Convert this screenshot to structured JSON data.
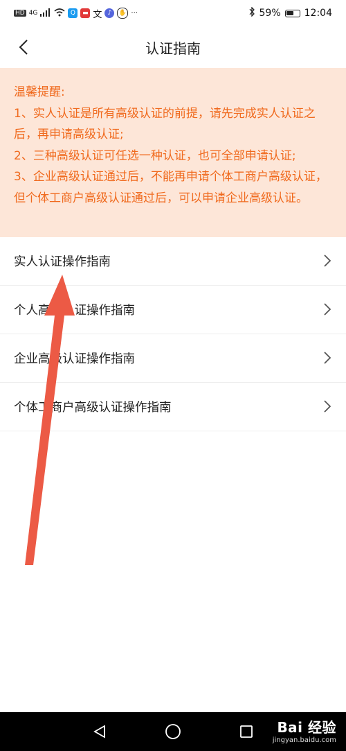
{
  "status_bar": {
    "left_tag": "HD",
    "network": "4G",
    "battery_percent": "59%",
    "time": "12:04",
    "battery_level": 0.59
  },
  "header": {
    "title": "认证指南"
  },
  "notice": {
    "heading": "温馨提醒:",
    "lines": [
      "1、实人认证是所有高级认证的前提，请先完成实人认证之后，再申请高级认证;",
      "2、三种高级认证可任选一种认证，也可全部申请认证;",
      "3、企业高级认证通过后，不能再申请个体工商户高级认证，但个体工商户高级认证通过后，可以申请企业高级认证。"
    ],
    "color": "#f06a1e",
    "background": "#fde6d8"
  },
  "menu": {
    "items": [
      {
        "label": "实人认证操作指南"
      },
      {
        "label": "个人高级认证操作指南"
      },
      {
        "label": "企业高级认证操作指南"
      },
      {
        "label": "个体工商户高级认证操作指南"
      }
    ]
  },
  "annotation": {
    "color": "#ec5a45"
  },
  "watermark": {
    "main": "Bai 经验",
    "sub": "jingyan.baidu.com"
  }
}
